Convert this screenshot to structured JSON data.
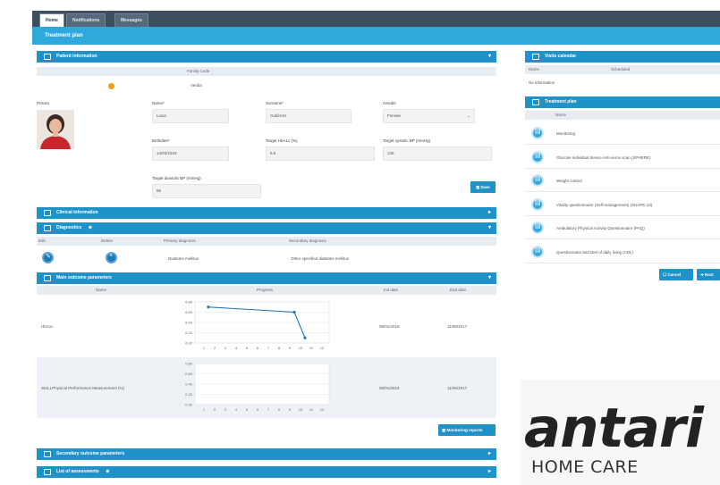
{
  "tabs": [
    "Home",
    "Notifications",
    "Messages"
  ],
  "page_title": "Treatment plan",
  "patient": {
    "header": "Patient information",
    "family_code_label": "Family Code",
    "family_code": "Verdia",
    "photo_label": "Picture",
    "fields": [
      {
        "label": "Name*",
        "value": "Luisa"
      },
      {
        "label": "Surname*",
        "value": "Gutiérrez"
      },
      {
        "label": "Gender",
        "value": "Female"
      },
      {
        "label": "Birthdate*",
        "value": "14/03/1943"
      },
      {
        "label": "Target HbA1c (%)",
        "value": "6.5"
      },
      {
        "label": "Target systolic BP (mmHg)",
        "value": "135"
      },
      {
        "label": "Target diastolic BP (mmHg)",
        "value": "85"
      }
    ],
    "save_label": "Save"
  },
  "clinical_information": {
    "header": "Clinical information"
  },
  "diagnostics": {
    "header": "Diagnostics",
    "columns": [
      "Edit",
      "Delete",
      "Primary diagnosis",
      "Secondary diagnosis"
    ],
    "row": {
      "primary": "Diabetes mellitus",
      "secondary": "Other specified diabetes mellitus"
    }
  },
  "main_outcomes": {
    "header": "Main outcome parameters",
    "columns": [
      "Name",
      "Progress",
      "Init date",
      "End date"
    ],
    "rows": [
      {
        "name": "HbA1c",
        "init": "05/01/2016",
        "end": "11/06/2017",
        "chart_data": {
          "type": "line",
          "title": "",
          "xlabel": "",
          "ylabel": "",
          "y_ticks": [
            "6.80",
            "6.60",
            "6.40",
            "6.20",
            "6.00"
          ],
          "x_ticks": [
            "1",
            "2",
            "3",
            "4",
            "5",
            "6",
            "7",
            "8",
            "9",
            "10",
            "11",
            "12"
          ],
          "x": [
            1,
            9,
            10
          ],
          "y": [
            6.7,
            6.6,
            6.1
          ],
          "ylim": [
            6.0,
            6.8
          ],
          "xlim": [
            0,
            12
          ]
        }
      },
      {
        "name": "SKILLPhysical Performance Measurement (%)",
        "init": "05/01/2016",
        "end": "11/06/2017",
        "chart_data": {
          "type": "line",
          "title": "",
          "xlabel": "",
          "ylabel": "",
          "y_ticks": [
            "0.80",
            "0.60",
            "0.40",
            "0.20",
            "0.00"
          ],
          "x_ticks": [
            "1",
            "2",
            "3",
            "4",
            "5",
            "6",
            "7",
            "8",
            "9",
            "10",
            "11",
            "12"
          ],
          "x": [],
          "y": [],
          "ylim": [
            0,
            0.8
          ],
          "xlim": [
            0,
            12
          ]
        }
      }
    ],
    "monitoring_label": "Monitoring reports"
  },
  "secondary_outcomes": {
    "header": "Secondary outcome parameters"
  },
  "assessments": {
    "header": "List of assessments"
  },
  "sidebar": {
    "visits": {
      "header": "Visits calendar",
      "columns": [
        "Name",
        "Scheduled"
      ],
      "note": "No information"
    },
    "treatment_plan": {
      "header": "Treatment plan",
      "column": "Name",
      "items": [
        "Monitoring",
        "Glucose individual device Anti-xerox scan (SPHERE)",
        "Weight control",
        "Vitality questionnaire (Self-management) (SHAPE-13)",
        "Ambulatory Physical Activity Questionnaire (PAQ)",
        "Questionnaire and Diet of daily living (ADL)"
      ],
      "cancel_label": "Cancel",
      "next_label": "Next"
    }
  },
  "brand": {
    "name": "antari",
    "tagline": "HOME CARE"
  },
  "colors": {
    "header": "#1f93c9",
    "title": "#2fa8dc",
    "topbar": "#3d4f5f",
    "line": "#1f77b4"
  }
}
